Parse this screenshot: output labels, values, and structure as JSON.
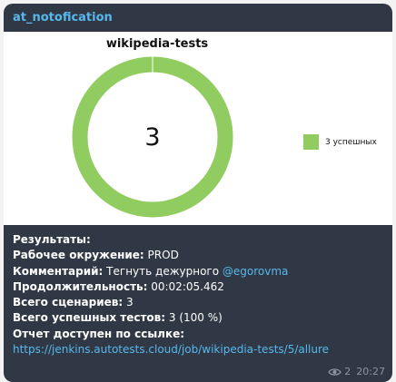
{
  "message": {
    "sender": "at_notofication",
    "lines": {
      "results_label": "Результаты:",
      "environment_label": "Рабочее окружение:",
      "environment_value": " PROD",
      "comment_label": "Комментарий:",
      "comment_value": " Тегнуть дежурного ",
      "comment_mention": "@egorovma",
      "duration_label": "Продолжительность:",
      "duration_value": " 00:02:05.462",
      "scenarios_label": "Всего сценариев:",
      "scenarios_value": " 3",
      "passed_label": "Всего успешных тестов:",
      "passed_value": " 3 (100 %)",
      "report_label": "Отчет доступен по ссылке:",
      "report_link": "https://jenkins.autotests.cloud/job/wikipedia-tests/5/allure"
    },
    "views": "2",
    "time": "20:27",
    "icons": {
      "views": "eye-icon"
    }
  },
  "chart_data": {
    "type": "pie",
    "title": "wikipedia-tests",
    "center_label": "3",
    "categories": [
      "3 успешных"
    ],
    "values": [
      3
    ],
    "colors": [
      "#90cc5f"
    ],
    "legend_position": "right"
  }
}
